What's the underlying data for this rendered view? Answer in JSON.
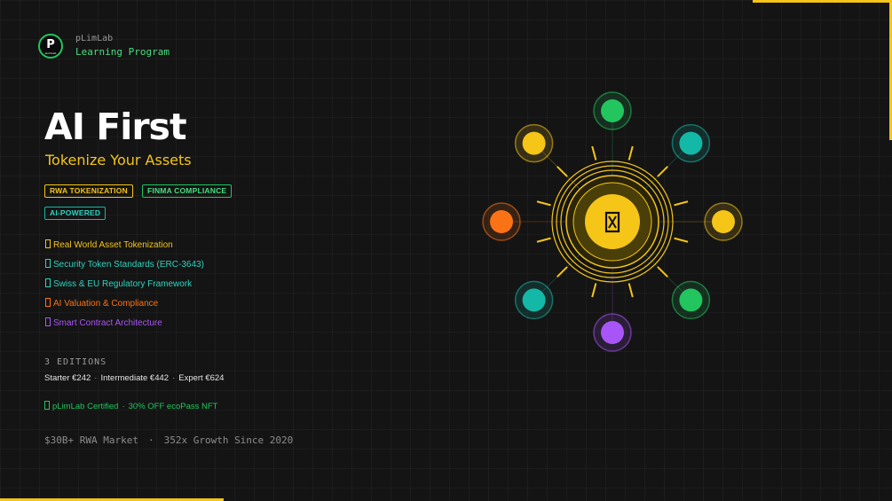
{
  "brand": {
    "logo_text": "P",
    "logo_small_text": "pLimLab",
    "name": "pLimLab",
    "program": "Learning Program"
  },
  "hero": {
    "title": "AI First",
    "subtitle": "Tokenize Your Assets"
  },
  "badges": [
    {
      "label": "RWA TOKENIZATION"
    },
    {
      "label": "FINMA COMPLIANCE"
    },
    {
      "label": "AI-POWERED"
    }
  ],
  "features": [
    {
      "text": "Real World Asset Tokenization"
    },
    {
      "text": "Security Token Standards (ERC-3643)"
    },
    {
      "text": "Swiss & EU Regulatory Framework"
    },
    {
      "text": "AI Valuation & Compliance"
    },
    {
      "text": "Smart Contract Architecture"
    }
  ],
  "editions": {
    "label": "3 EDITIONS",
    "items": [
      {
        "text": "Starter €242"
      },
      {
        "text": "Intermediate €442"
      },
      {
        "text": "Expert €624"
      }
    ],
    "separator": "·"
  },
  "certification": {
    "items": [
      {
        "text": "pLimLab Certified"
      },
      {
        "text": "30% OFF ecoPass NFT"
      }
    ]
  },
  "stats": {
    "items": [
      {
        "text": "$30B+ RWA Market"
      },
      {
        "text": "352x Growth Since 2020"
      }
    ],
    "separator": "·"
  },
  "colors": {
    "background": "#141414",
    "yellow": "#f5c518",
    "green": "#22c55e",
    "teal": "#14b8a6",
    "orange": "#f97316",
    "purple": "#a855f7",
    "gray": "#9a9a9a"
  },
  "hub": {
    "center_icon": "token-icon",
    "nodes": [
      {
        "name": "green-node",
        "color": "#22c55e"
      },
      {
        "name": "teal-node",
        "color": "#14b8a6"
      },
      {
        "name": "yellow-node",
        "color": "#f5c518"
      },
      {
        "name": "green-node",
        "color": "#22c55e"
      },
      {
        "name": "purple-node",
        "color": "#a855f7"
      },
      {
        "name": "teal-node",
        "color": "#14b8a6"
      },
      {
        "name": "orange-node",
        "color": "#f97316"
      },
      {
        "name": "yellow-node",
        "color": "#f5c518"
      }
    ]
  }
}
